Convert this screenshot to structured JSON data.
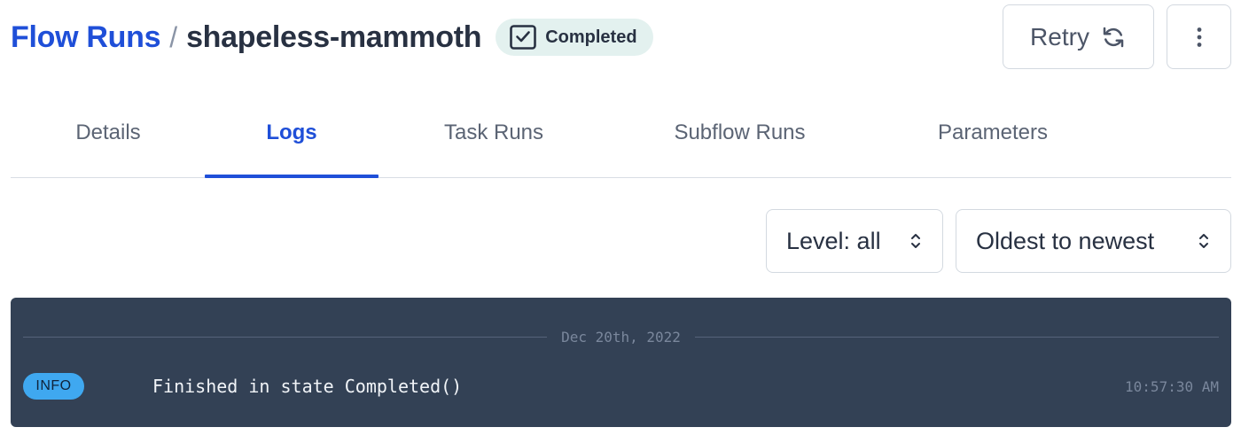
{
  "header": {
    "breadcrumb_root": "Flow Runs",
    "breadcrumb_separator": "/",
    "run_name": "shapeless-mammoth",
    "state_label": "Completed",
    "retry_label": "Retry",
    "icons": {
      "state": "check-square-icon",
      "retry": "refresh-icon",
      "menu": "more-vertical-icon"
    }
  },
  "tabs": [
    {
      "label": "Details",
      "active": false
    },
    {
      "label": "Logs",
      "active": true
    },
    {
      "label": "Task Runs",
      "active": false
    },
    {
      "label": "Subflow Runs",
      "active": false
    },
    {
      "label": "Parameters",
      "active": false
    }
  ],
  "filters": {
    "level": {
      "selected": "Level: all"
    },
    "order": {
      "selected": "Oldest to newest"
    }
  },
  "logs": {
    "date_divider": "Dec 20th, 2022",
    "entries": [
      {
        "level": "INFO",
        "message": "Finished in state Completed()",
        "time": "10:57:30 AM"
      }
    ]
  },
  "colors": {
    "accent": "#1f4fd8",
    "completed_badge_bg": "#e3f1ef",
    "log_panel_bg": "#334155",
    "info_badge": "#3fa8f0"
  }
}
